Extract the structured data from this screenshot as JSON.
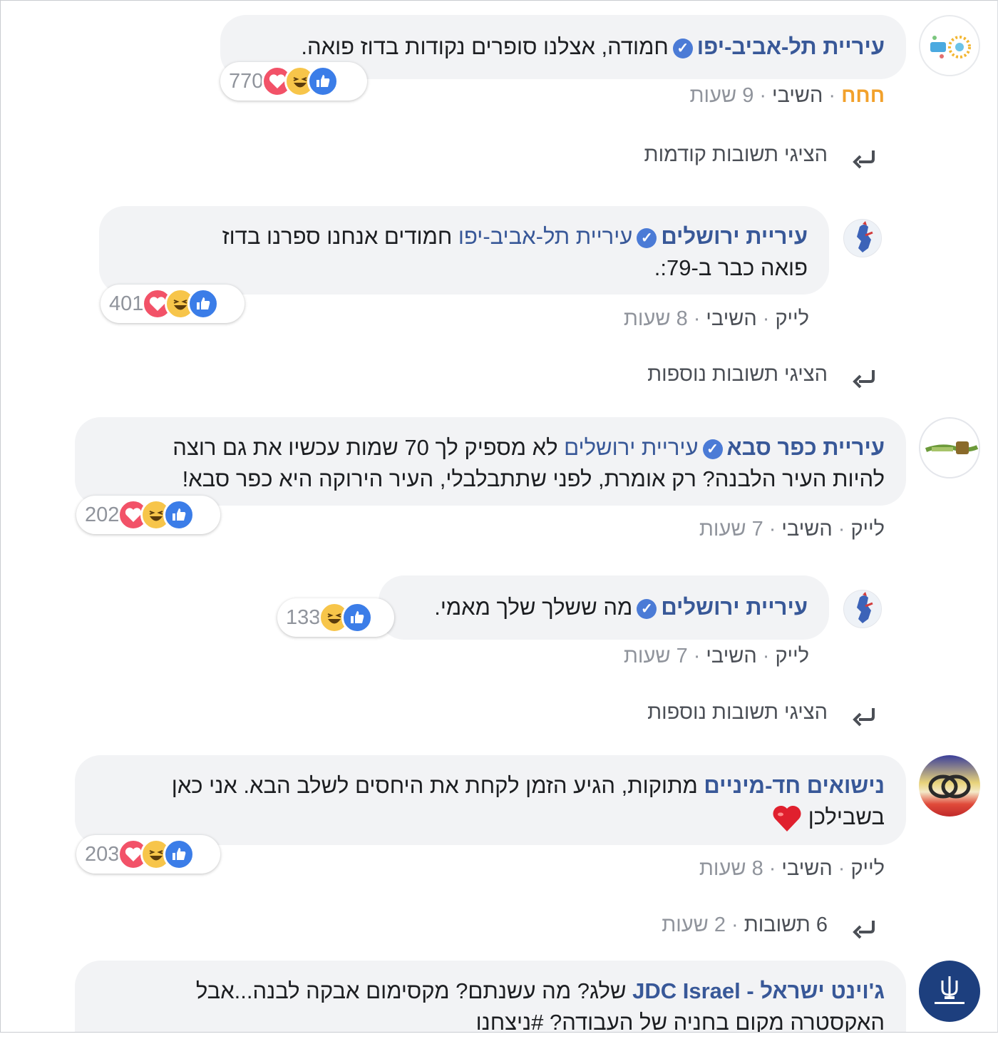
{
  "comments": [
    {
      "author": "עיריית תל-אביב-יפו",
      "text": "חמודה, אצלנו סופרים נקודות בדוז פואה.",
      "reaction_count": "770",
      "actions": {
        "like": "חחח",
        "reply": "השיבי",
        "time": "9 שעות"
      }
    },
    {
      "author": "עיריית ירושלים",
      "mention": "עיריית תל-אביב-יפו",
      "text": "חמודים אנחנו ספרנו בדוז פואה כבר ב-79:.",
      "text_line1": "חמודים אנחנו ספרנו בדוז",
      "text_line2": "פואה כבר ב-79:.",
      "reaction_count": "401",
      "actions": {
        "like": "לייק",
        "reply": "השיבי",
        "time": "8 שעות"
      }
    },
    {
      "author": "עיריית כפר סבא",
      "mention": "עיריית ירושלים",
      "text_line1": "לא מספיק לך 70 שמות עכשיו את גם רוצה",
      "text_line2": "להיות העיר הלבנה? רק אומרת, לפני שתתבלבלי, העיר הירוקה היא כפר סבא!",
      "reaction_count": "202",
      "actions": {
        "like": "לייק",
        "reply": "השיבי",
        "time": "7 שעות"
      }
    },
    {
      "author": "עיריית ירושלים",
      "text": "מה ששלך שלך מאמי.",
      "reaction_count": "133",
      "actions": {
        "like": "לייק",
        "reply": "השיבי",
        "time": "7 שעות"
      }
    },
    {
      "author": "נישואים חד-מיניים",
      "text_line1": "מתוקות, הגיע הזמן לקחת את היחסים לשלב הבא. אני כאן",
      "text_line2": "בשבילכן",
      "reaction_count": "203",
      "actions": {
        "like": "לייק",
        "reply": "השיבי",
        "time": "8 שעות"
      }
    },
    {
      "author": "ג'וינט ישראל - JDC Israel",
      "text_line1": "שלג? מה עשנתם? מקסימום אבקה לבנה...אבל",
      "text_line2": "האקסטרה מקום בחניה של העבודה? #ניצחנו"
    }
  ],
  "view_previous_replies": "הציגי תשובות קודמות",
  "view_more_replies_1": "הציגי תשובות נוספות",
  "view_more_replies_2": "הציגי תשובות נוספות",
  "replies_summary": {
    "count": "6 תשובות",
    "time": "2 שעות"
  },
  "colors": {
    "name": "#385898",
    "bubble": "#f2f3f5",
    "accent": "#f2a12b",
    "like": "#3b7de8",
    "love": "#f25268",
    "haha": "#f7c54a"
  },
  "icons": [
    "verified-badge-icon",
    "like-reaction-icon",
    "haha-reaction-icon",
    "love-reaction-icon",
    "reply-arrow-icon",
    "red-heart-emoji-icon"
  ]
}
